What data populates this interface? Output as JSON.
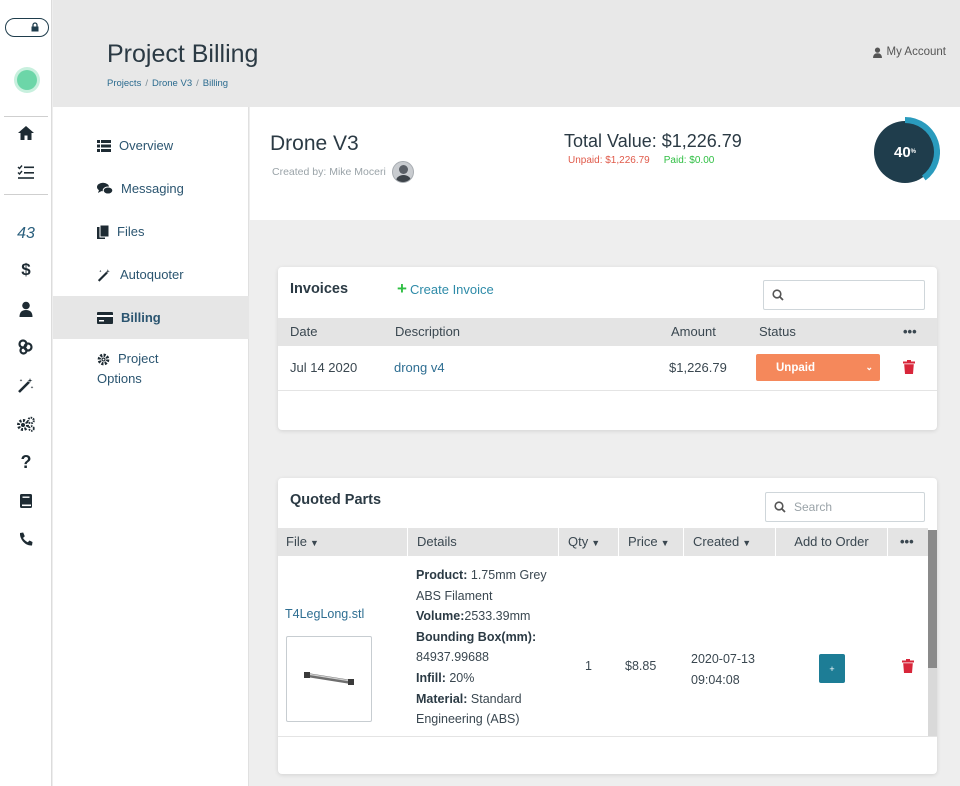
{
  "header": {
    "title": "Project Billing",
    "breadcrumb": [
      "Projects",
      "Drone V3",
      "Billing"
    ],
    "account_label": "My Account"
  },
  "rail": {
    "count_label": "43",
    "icons": [
      "lock-icon",
      "home-icon",
      "task-list-icon",
      "dollar-icon",
      "user-icon",
      "handshake-icon",
      "magic-wand-icon",
      "gears-icon",
      "question-icon",
      "book-icon",
      "phone-icon"
    ]
  },
  "nav": {
    "items": [
      {
        "label": "Overview",
        "icon": "list-icon"
      },
      {
        "label": "Messaging",
        "icon": "chat-icon"
      },
      {
        "label": "Files",
        "icon": "files-icon"
      },
      {
        "label": "Autoquoter",
        "icon": "magic-wand-icon"
      },
      {
        "label": "Billing",
        "icon": "credit-card-icon",
        "active": true
      },
      {
        "label_line1": "Project",
        "label_line2": "Options",
        "icon": "gear-icon"
      }
    ]
  },
  "project": {
    "name": "Drone V3",
    "created_by": "Created by: Mike Moceri",
    "total_value": "Total Value: $1,226.79",
    "unpaid": "Unpaid: $1,226.79",
    "paid": "Paid: $0.00",
    "progress_percent": 40,
    "progress_label": "40",
    "progress_unit": "%",
    "colors": {
      "gauge_dark": "#1f3d4c",
      "gauge_ring": "#2a9bbd",
      "unpaid": "#e05a4a",
      "paid": "#2fbf43"
    }
  },
  "invoices": {
    "title": "Invoices",
    "create_label": "Create Invoice",
    "search_placeholder": "",
    "columns": [
      "Date",
      "Description",
      "Amount",
      "Status",
      "•••"
    ],
    "rows": [
      {
        "date": "Jul 14 2020",
        "description": "drong v4",
        "amount": "$1,226.79",
        "status": "Unpaid"
      }
    ],
    "status_color": "#f5885b"
  },
  "quoted_parts": {
    "title": "Quoted Parts",
    "search_placeholder": "Search",
    "columns": [
      "File",
      "Details",
      "Qty",
      "Price",
      "Created",
      "Add to Order",
      "•••"
    ],
    "rows": [
      {
        "file": "T4LegLong.stl",
        "details": {
          "product_label": "Product:",
          "product": "1.75mm Grey ABS Filament",
          "volume_label": "Volume:",
          "volume": "2533.39mm",
          "bbox_label": "Bounding Box(mm):",
          "bbox": "84937.99688",
          "infill_label": "Infill:",
          "infill": "20%",
          "material_label": "Material:",
          "material": "Standard Engineering (ABS)"
        },
        "qty": "1",
        "price": "$8.85",
        "created_date": "2020-07-13",
        "created_time": "09:04:08",
        "add_label": "+"
      }
    ]
  }
}
